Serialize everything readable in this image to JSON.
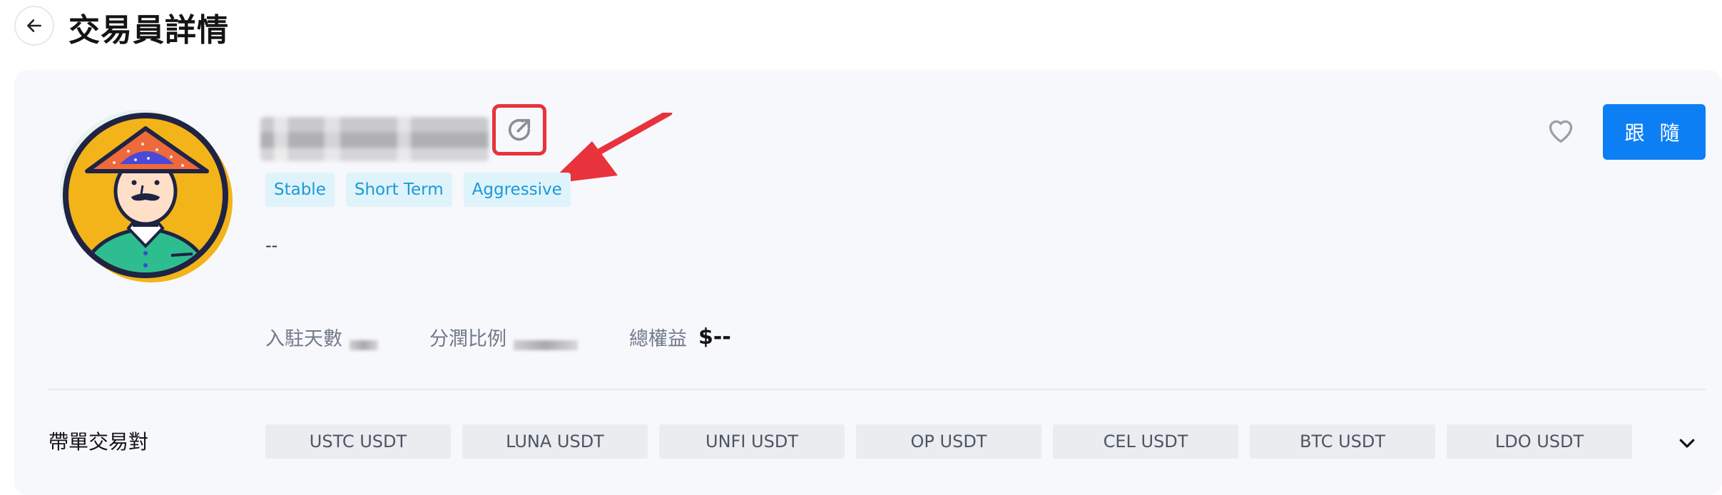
{
  "header": {
    "title": "交易員詳情"
  },
  "trader": {
    "tags": [
      "Stable",
      "Short Term",
      "Aggressive"
    ],
    "description": "--",
    "stats": {
      "days_label": "入駐天數",
      "share_label": "分潤比例",
      "equity_label": "總權益",
      "equity_value": "$--"
    }
  },
  "actions": {
    "follow_label": "跟 隨"
  },
  "pairs": {
    "label": "帶單交易對",
    "items": [
      "USTC USDT",
      "LUNA USDT",
      "UNFI USDT",
      "OP USDT",
      "CEL USDT",
      "BTC USDT",
      "LDO USDT"
    ]
  },
  "icons": {
    "back": "arrow-left-icon",
    "share": "share-icon",
    "favorite": "heart-icon",
    "expand": "chevron-down-icon"
  },
  "colors": {
    "accent": "#0d7ff5",
    "tag_bg": "#dff3fb",
    "tag_text": "#1a9ad6",
    "highlight": "#e8323c"
  }
}
